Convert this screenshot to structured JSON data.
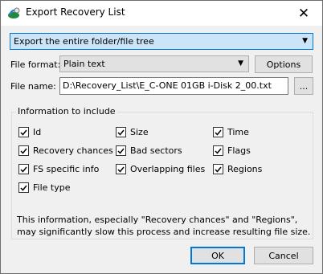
{
  "window": {
    "title": "Export Recovery List",
    "close_symbol": "✕"
  },
  "export_scope": {
    "value": "Export the entire folder/file tree"
  },
  "file_format": {
    "label": "File format:",
    "value": "Plain text",
    "options_button": "Options"
  },
  "file_name": {
    "label": "File name:",
    "value": "D:\\Recovery_List\\E_C-ONE 01GB i-Disk 2_00.txt",
    "browse_button": "..."
  },
  "info": {
    "group_title": "Information to include",
    "items": [
      {
        "label": "Id",
        "checked": true
      },
      {
        "label": "Size",
        "checked": true
      },
      {
        "label": "Time",
        "checked": true
      },
      {
        "label": "Recovery chances",
        "checked": true
      },
      {
        "label": "Bad sectors",
        "checked": true
      },
      {
        "label": "Flags",
        "checked": true
      },
      {
        "label": "FS specific info",
        "checked": true
      },
      {
        "label": "Overlapping files",
        "checked": true
      },
      {
        "label": "Regions",
        "checked": true
      },
      {
        "label": "File type",
        "checked": true
      }
    ],
    "note": "This information, especially \"Recovery chances\" and \"Regions\", may significantly slow this process and increase resulting file size."
  },
  "actions": {
    "ok": "OK",
    "cancel": "Cancel"
  }
}
